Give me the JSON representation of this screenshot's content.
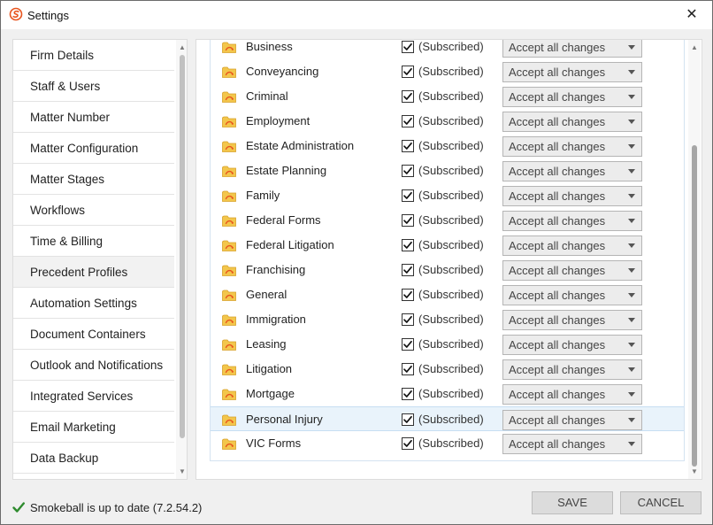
{
  "window": {
    "title": "Settings",
    "close_symbol": "✕",
    "app_icon": "smokeball-logo-icon"
  },
  "nav": {
    "items": [
      {
        "label": "Firm Details",
        "selected": false
      },
      {
        "label": "Staff & Users",
        "selected": false
      },
      {
        "label": "Matter Number",
        "selected": false
      },
      {
        "label": "Matter Configuration",
        "selected": false
      },
      {
        "label": "Matter Stages",
        "selected": false
      },
      {
        "label": "Workflows",
        "selected": false
      },
      {
        "label": "Time & Billing",
        "selected": false
      },
      {
        "label": "Precedent Profiles",
        "selected": true
      },
      {
        "label": "Automation Settings",
        "selected": false
      },
      {
        "label": "Document Containers",
        "selected": false
      },
      {
        "label": "Outlook and Notifications",
        "selected": false
      },
      {
        "label": "Integrated Services",
        "selected": false
      },
      {
        "label": "Email Marketing",
        "selected": false
      },
      {
        "label": "Data Backup",
        "selected": false
      }
    ]
  },
  "profiles": {
    "rows": [
      {
        "name": "Business",
        "subscribed": true,
        "status": "(Subscribed)",
        "option": "Accept all changes"
      },
      {
        "name": "Conveyancing",
        "subscribed": true,
        "status": "(Subscribed)",
        "option": "Accept all changes"
      },
      {
        "name": "Criminal",
        "subscribed": true,
        "status": "(Subscribed)",
        "option": "Accept all changes"
      },
      {
        "name": "Employment",
        "subscribed": true,
        "status": "(Subscribed)",
        "option": "Accept all changes"
      },
      {
        "name": "Estate Administration",
        "subscribed": true,
        "status": "(Subscribed)",
        "option": "Accept all changes"
      },
      {
        "name": "Estate Planning",
        "subscribed": true,
        "status": "(Subscribed)",
        "option": "Accept all changes"
      },
      {
        "name": "Family",
        "subscribed": true,
        "status": "(Subscribed)",
        "option": "Accept all changes"
      },
      {
        "name": "Federal Forms",
        "subscribed": true,
        "status": "(Subscribed)",
        "option": "Accept all changes"
      },
      {
        "name": "Federal Litigation",
        "subscribed": true,
        "status": "(Subscribed)",
        "option": "Accept all changes"
      },
      {
        "name": "Franchising",
        "subscribed": true,
        "status": "(Subscribed)",
        "option": "Accept all changes"
      },
      {
        "name": "General",
        "subscribed": true,
        "status": "(Subscribed)",
        "option": "Accept all changes"
      },
      {
        "name": "Immigration",
        "subscribed": true,
        "status": "(Subscribed)",
        "option": "Accept all changes"
      },
      {
        "name": "Leasing",
        "subscribed": true,
        "status": "(Subscribed)",
        "option": "Accept all changes"
      },
      {
        "name": "Litigation",
        "subscribed": true,
        "status": "(Subscribed)",
        "option": "Accept all changes"
      },
      {
        "name": "Mortgage",
        "subscribed": true,
        "status": "(Subscribed)",
        "option": "Accept all changes"
      },
      {
        "name": "Personal Injury",
        "subscribed": true,
        "status": "(Subscribed)",
        "option": "Accept all changes",
        "highlighted": true
      },
      {
        "name": "VIC Forms",
        "subscribed": true,
        "status": "(Subscribed)",
        "option": "Accept all changes"
      }
    ]
  },
  "footer": {
    "status_icon": "checkmark-icon",
    "status_text": "Smokeball is up to date (7.2.54.2)",
    "save_label": "SAVE",
    "cancel_label": "CANCEL"
  },
  "colors": {
    "check_green": "#2e8b2e",
    "folder_yellow": "#f3c64b",
    "logo_orange": "#e8541e",
    "highlight_row": "#e9f3fb"
  }
}
